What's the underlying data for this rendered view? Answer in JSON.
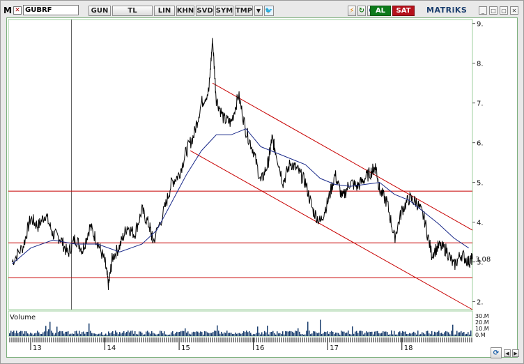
{
  "toolbar": {
    "symbol": "GUBRF",
    "buttons": [
      "GUN",
      "TL",
      "LIN",
      "KHN",
      "SVD",
      "SYM",
      "TMP"
    ],
    "buy_label": "AL",
    "sell_label": "SAT",
    "brand": "MATRiKS",
    "colors": {
      "buy": "#0c7a1a",
      "sell": "#b5121b",
      "brand": "#1a3e6e"
    }
  },
  "chart_data": [
    {
      "type": "line",
      "y_axis": {
        "ticks": [
          "9.",
          "8.",
          "7.",
          "6.",
          "5.",
          "4.",
          "3.",
          "2."
        ],
        "range": [
          1.8,
          9.1
        ],
        "position": "right"
      },
      "x_axis": {
        "tick_labels": [
          "13",
          "14",
          "15",
          "16",
          "17",
          "18"
        ]
      },
      "last_value_label": "3.08",
      "series": [
        {
          "color": "#000000"
        },
        {
          "color": "#1a2a8a"
        }
      ],
      "x_range": [
        2012.7,
        2018.95
      ],
      "price": [
        [
          2012.75,
          3.0
        ],
        [
          2012.9,
          3.4
        ],
        [
          2013.0,
          4.1
        ],
        [
          2013.1,
          3.9
        ],
        [
          2013.2,
          4.2
        ],
        [
          2013.3,
          3.7
        ],
        [
          2013.4,
          3.6
        ],
        [
          2013.5,
          3.2
        ],
        [
          2013.6,
          3.6
        ],
        [
          2013.7,
          3.3
        ],
        [
          2013.8,
          3.9
        ],
        [
          2013.9,
          3.5
        ],
        [
          2014.0,
          3.0
        ],
        [
          2014.05,
          2.4
        ],
        [
          2014.1,
          3.1
        ],
        [
          2014.2,
          3.4
        ],
        [
          2014.3,
          3.9
        ],
        [
          2014.4,
          3.7
        ],
        [
          2014.5,
          4.3
        ],
        [
          2014.6,
          3.9
        ],
        [
          2014.65,
          3.5
        ],
        [
          2014.8,
          4.3
        ],
        [
          2014.9,
          5.0
        ],
        [
          2015.0,
          5.2
        ],
        [
          2015.1,
          5.8
        ],
        [
          2015.2,
          6.2
        ],
        [
          2015.3,
          7.0
        ],
        [
          2015.4,
          7.3
        ],
        [
          2015.45,
          8.6
        ],
        [
          2015.5,
          7.1
        ],
        [
          2015.6,
          6.6
        ],
        [
          2015.7,
          6.5
        ],
        [
          2015.8,
          7.2
        ],
        [
          2015.9,
          6.3
        ],
        [
          2016.0,
          5.8
        ],
        [
          2016.1,
          5.0
        ],
        [
          2016.2,
          5.5
        ],
        [
          2016.25,
          6.1
        ],
        [
          2016.3,
          5.8
        ],
        [
          2016.4,
          5.0
        ],
        [
          2016.5,
          5.5
        ],
        [
          2016.6,
          5.3
        ],
        [
          2016.7,
          5.0
        ],
        [
          2016.8,
          4.3
        ],
        [
          2016.9,
          4.0
        ],
        [
          2017.0,
          4.5
        ],
        [
          2017.1,
          5.2
        ],
        [
          2017.2,
          4.6
        ],
        [
          2017.3,
          5.0
        ],
        [
          2017.4,
          4.9
        ],
        [
          2017.5,
          5.1
        ],
        [
          2017.6,
          5.3
        ],
        [
          2017.65,
          5.4
        ],
        [
          2017.7,
          4.8
        ],
        [
          2017.8,
          4.5
        ],
        [
          2017.9,
          3.6
        ],
        [
          2018.0,
          4.3
        ],
        [
          2018.1,
          4.6
        ],
        [
          2018.2,
          4.5
        ],
        [
          2018.3,
          4.1
        ],
        [
          2018.4,
          3.2
        ],
        [
          2018.5,
          3.4
        ],
        [
          2018.6,
          3.3
        ],
        [
          2018.7,
          2.9
        ],
        [
          2018.8,
          3.2
        ],
        [
          2018.9,
          3.0
        ],
        [
          2018.95,
          3.08
        ]
      ],
      "moving_average": [
        [
          2012.75,
          2.95
        ],
        [
          2013.0,
          3.35
        ],
        [
          2013.3,
          3.55
        ],
        [
          2013.6,
          3.45
        ],
        [
          2013.9,
          3.45
        ],
        [
          2014.2,
          3.25
        ],
        [
          2014.5,
          3.45
        ],
        [
          2014.7,
          3.8
        ],
        [
          2014.9,
          4.5
        ],
        [
          2015.1,
          5.2
        ],
        [
          2015.3,
          5.8
        ],
        [
          2015.5,
          6.2
        ],
        [
          2015.7,
          6.2
        ],
        [
          2015.9,
          6.35
        ],
        [
          2016.1,
          5.9
        ],
        [
          2016.3,
          5.75
        ],
        [
          2016.5,
          5.6
        ],
        [
          2016.7,
          5.45
        ],
        [
          2016.9,
          5.1
        ],
        [
          2017.1,
          4.95
        ],
        [
          2017.3,
          4.9
        ],
        [
          2017.5,
          4.95
        ],
        [
          2017.7,
          5.0
        ],
        [
          2017.9,
          4.7
        ],
        [
          2018.1,
          4.55
        ],
        [
          2018.3,
          4.25
        ],
        [
          2018.5,
          3.95
        ],
        [
          2018.7,
          3.6
        ],
        [
          2018.9,
          3.35
        ]
      ],
      "horizontal_lines": [
        4.78,
        3.48,
        2.6
      ],
      "horizontal_line_color": "#c80000",
      "channel_upper": [
        [
          2015.45,
          7.5
        ],
        [
          2018.95,
          3.8
        ]
      ],
      "channel_lower": [
        [
          2015.15,
          5.8
        ],
        [
          2018.95,
          1.8
        ]
      ],
      "channel_color": "#c80000",
      "cursor_line_x": 2013.55
    },
    {
      "type": "bar",
      "title": "Volume",
      "y_ticks": [
        "30.M",
        "20.M",
        "10.M",
        "0.M"
      ],
      "color": "#1a3e6e"
    }
  ]
}
